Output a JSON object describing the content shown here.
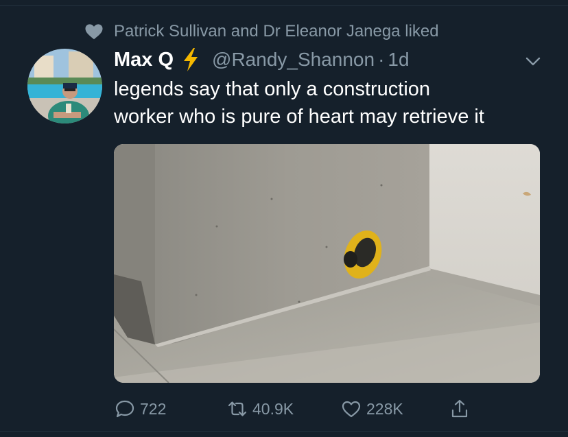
{
  "social_context": {
    "icon": "heart-icon",
    "text": "Patrick Sullivan and Dr Eleanor Janega liked"
  },
  "author": {
    "display_name": "Max Q",
    "emoji": "lightning-icon",
    "handle": "@Randy_Shannon",
    "separator": "·",
    "time": "1d"
  },
  "tweet": {
    "lines": [
      "legends say that only a construction",
      "worker who is pure of heart may retrieve it"
    ]
  },
  "actions": {
    "replies": "722",
    "retweets": "40.9K",
    "likes": "228K"
  },
  "colors": {
    "background": "#15202b",
    "secondary_text": "#8899a6",
    "primary_text": "#ffffff",
    "bolt": "#f5b800"
  }
}
